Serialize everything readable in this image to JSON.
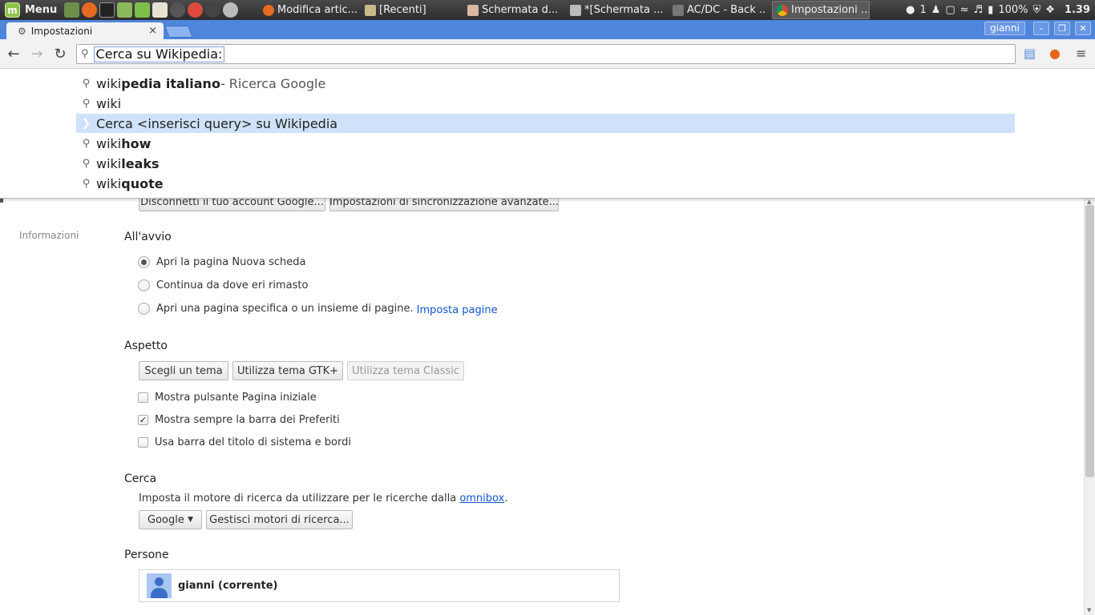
{
  "taskbar": {
    "menu_label": "Menu",
    "tasks": [
      {
        "label": "Modifica artic...",
        "icon": "firefox-icon"
      },
      {
        "label": "[Recenti]",
        "icon": "folder-icon"
      },
      {
        "label": "Schermata d...",
        "icon": "image-viewer-icon"
      },
      {
        "label": "*[Schermata ...",
        "icon": "image-editor-icon"
      },
      {
        "label": "AC/DC - Back ...",
        "icon": "media-player-icon"
      },
      {
        "label": "Impostazioni ...",
        "icon": "chrome-icon"
      }
    ],
    "tray": {
      "notifications": "1",
      "battery": "100%",
      "clock": "1.39"
    }
  },
  "browser": {
    "tab_title": "Impostazioni",
    "user": "gianni",
    "keyword_chip": "Cerca su Wikipedia:",
    "omnibox_value": ""
  },
  "suggestions": [
    {
      "prefix": "wiki",
      "bold": "pedia italiano",
      "suffix": " - Ricerca Google",
      "icon": "search-icon"
    },
    {
      "prefix": "wiki",
      "bold": "",
      "suffix": "",
      "icon": "search-icon"
    },
    {
      "prefix": "Cerca <inserisci query> su Wikipedia",
      "bold": "",
      "suffix": "",
      "icon": "arrow-icon",
      "selected": true
    },
    {
      "prefix": "wiki",
      "bold": "how",
      "suffix": "",
      "icon": "search-icon"
    },
    {
      "prefix": "wiki",
      "bold": "leaks",
      "suffix": "",
      "icon": "search-icon"
    },
    {
      "prefix": "wiki",
      "bold": "quote",
      "suffix": "",
      "icon": "search-icon"
    }
  ],
  "settings": {
    "sidebar_info": "Informazioni",
    "sync": {
      "disconnect_btn": "Disconnetti il tuo account Google...",
      "advanced_btn": "Impostazioni di sincronizzazione avanzate..."
    },
    "startup": {
      "title": "All'avvio",
      "opt_new_tab": "Apri la pagina Nuova scheda",
      "opt_continue": "Continua da dove eri rimasto",
      "opt_specific": "Apri una pagina specifica o un insieme di pagine.",
      "set_pages_link": "Imposta pagine",
      "selected": "opt_new_tab"
    },
    "appearance": {
      "title": "Aspetto",
      "choose_theme_btn": "Scegli un tema",
      "gtk_theme_btn": "Utilizza tema GTK+",
      "classic_theme_btn": "Utilizza tema Classic",
      "show_home": "Mostra pulsante Pagina iniziale",
      "show_home_checked": false,
      "show_bookmarks": "Mostra sempre la barra dei Preferiti",
      "show_bookmarks_checked": true,
      "system_titlebar": "Usa barra del titolo di sistema e bordi",
      "system_titlebar_checked": false
    },
    "search": {
      "title": "Cerca",
      "desc_prefix": "Imposta il motore di ricerca da utilizzare per le ricerche dalla ",
      "desc_link": "omnibox",
      "desc_suffix": ".",
      "engine": "Google",
      "manage_btn": "Gestisci motori di ricerca..."
    },
    "people": {
      "title": "Persone",
      "current_user": "gianni (corrente)"
    }
  }
}
